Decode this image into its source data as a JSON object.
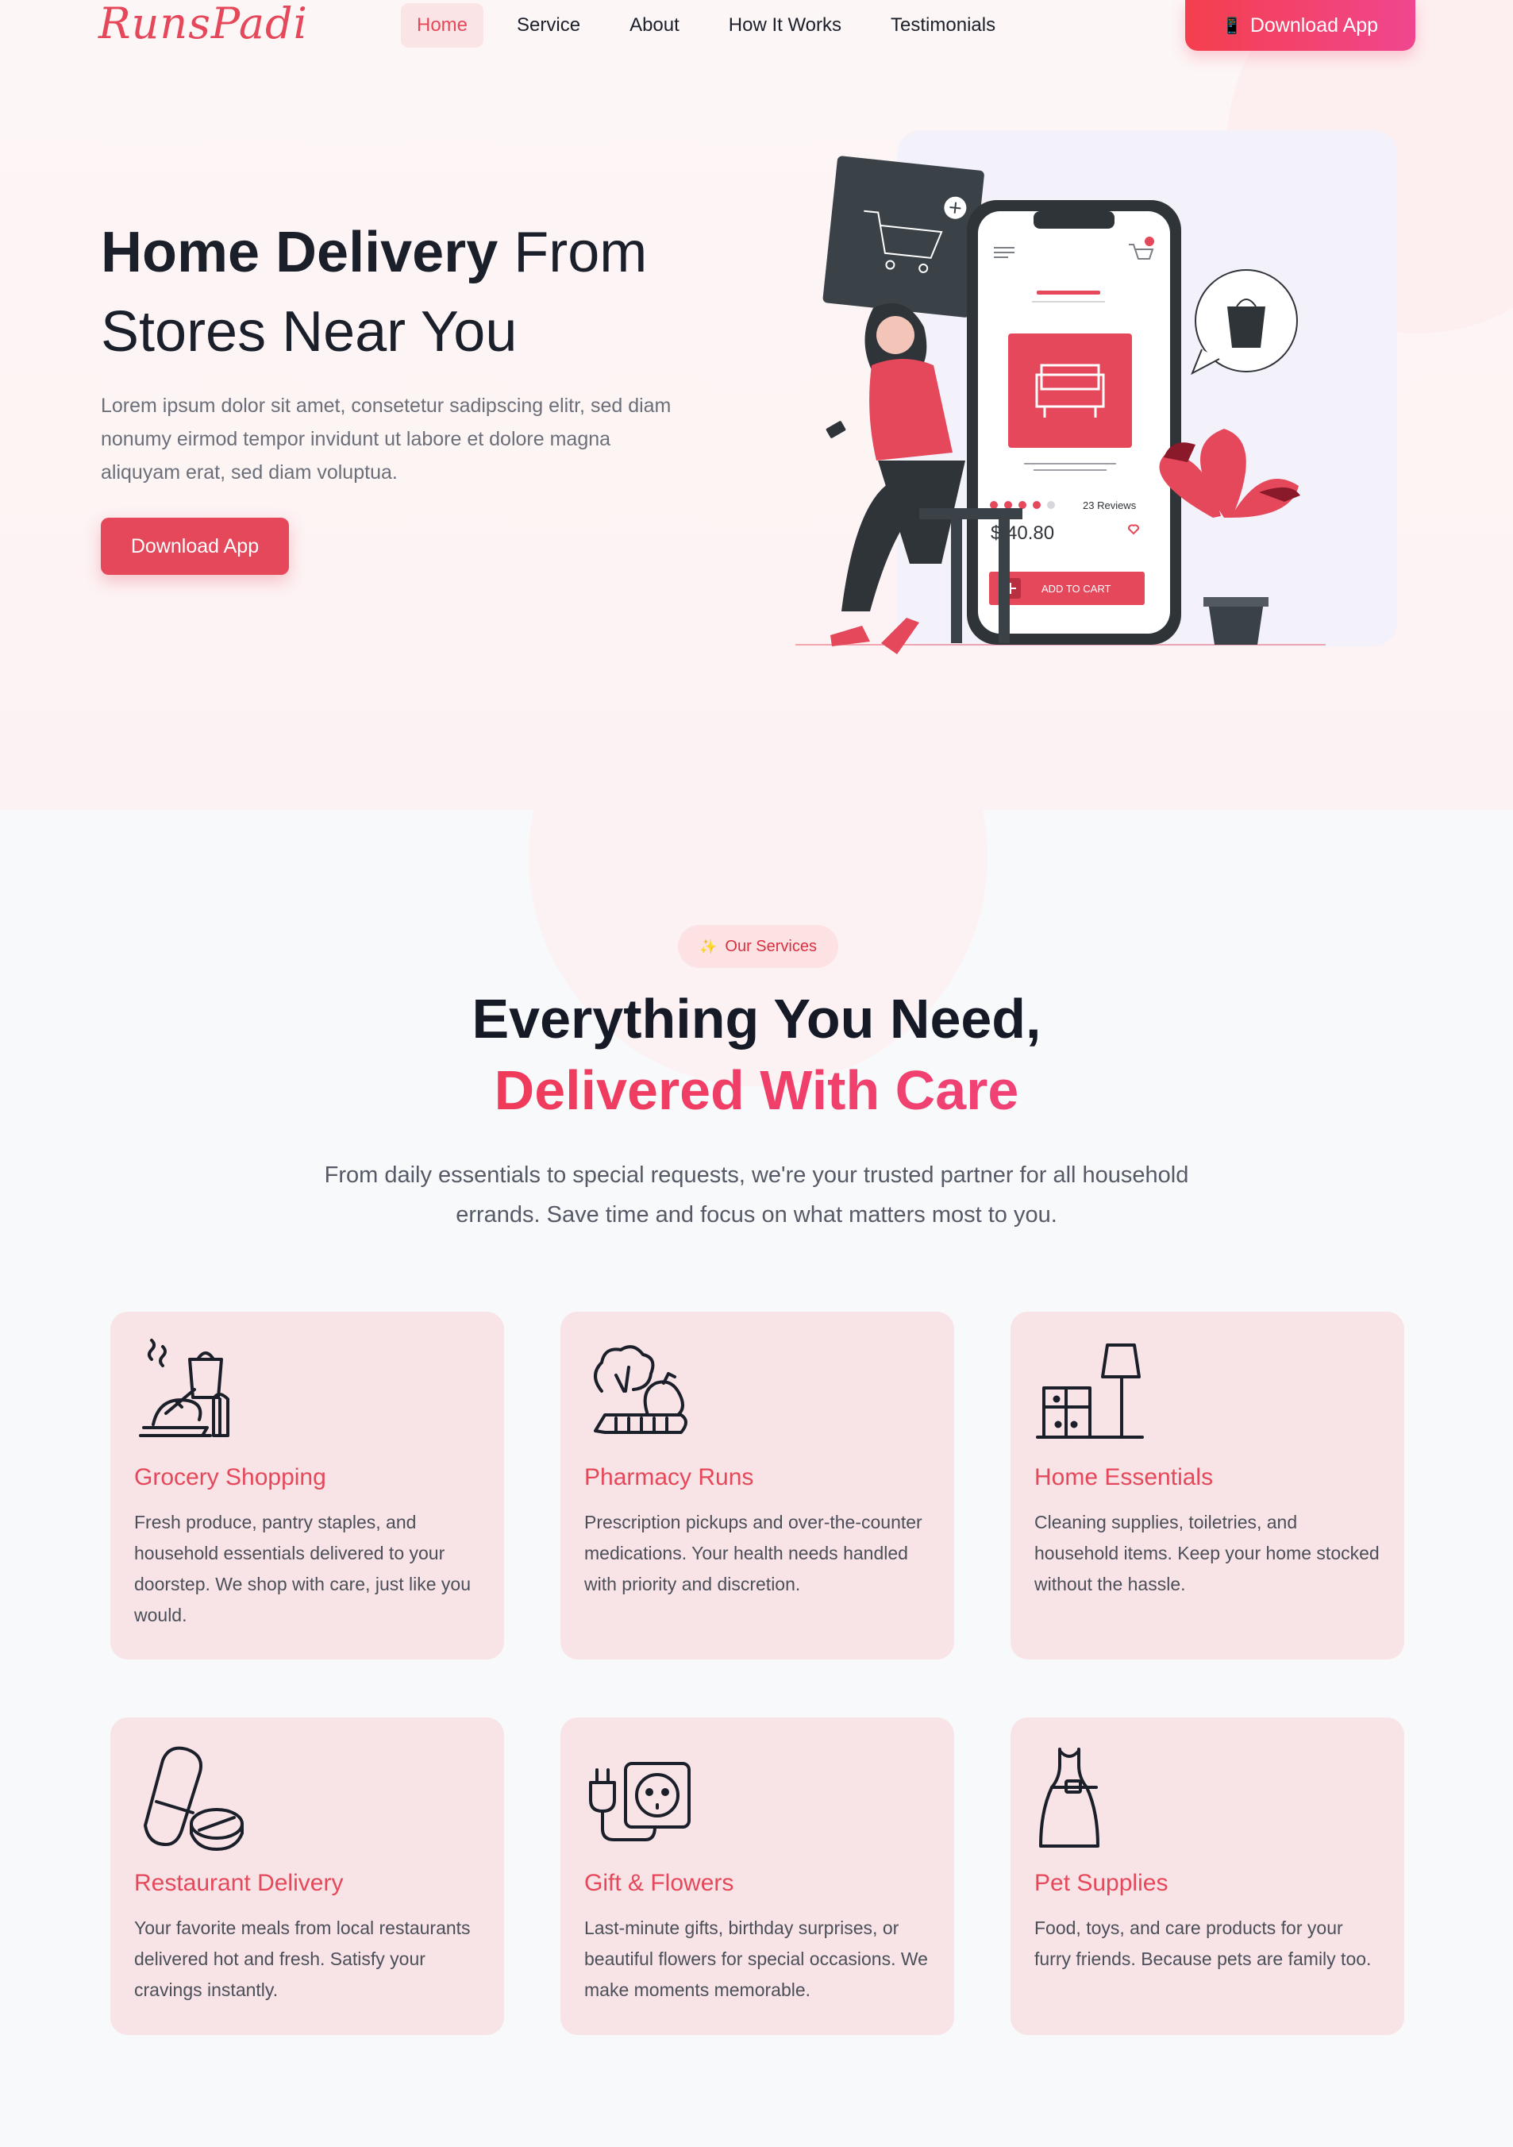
{
  "brand": {
    "logo_text": "RunsPadi",
    "primary_color": "#e5485a",
    "accent_gradient": [
      "#f43f4d",
      "#f0468f"
    ]
  },
  "nav": {
    "items": [
      {
        "label": "Home",
        "active": true
      },
      {
        "label": "Service",
        "active": false
      },
      {
        "label": "About",
        "active": false
      },
      {
        "label": "How It Works",
        "active": false
      },
      {
        "label": "Testimonials",
        "active": false
      }
    ],
    "cta_icon": "phone-icon",
    "cta_label": "Download App"
  },
  "hero": {
    "title_bold": "Home Delivery",
    "title_rest": " From Stores Near You",
    "text": "Lorem ipsum dolor sit amet, consetetur sadipscing elitr, sed diam nonumy eirmod tempor invidunt ut labore et dolore magna aliquyam erat, sed diam voluptua.",
    "button_label": "Download App",
    "illustration": {
      "reviews_label": "23 Reviews",
      "price": "$ 40.80",
      "add_to_cart_label": "ADD TO CART",
      "stars": 4
    }
  },
  "services": {
    "badge_icon": "sparkle-icon",
    "badge_label": "Our Services",
    "title_line1": "Everything You Need,",
    "title_line2": "Delivered With Care",
    "subtitle": "From daily essentials to special requests, we're your trusted partner for all household errands. Save time and focus on what matters most to you.",
    "cards": [
      {
        "icon": "grocery-icon",
        "title": "Grocery Shopping",
        "text": "Fresh produce, pantry staples, and household essentials delivered to your doorstep. We shop with care, just like you would."
      },
      {
        "icon": "vegetables-icon",
        "title": "Pharmacy Runs",
        "text": "Prescription pickups and over-the-counter medications. Your health needs handled with priority and discretion."
      },
      {
        "icon": "furniture-lamp-icon",
        "title": "Home Essentials",
        "text": "Cleaning supplies, toiletries, and household items. Keep your home stocked without the hassle."
      },
      {
        "icon": "pills-icon",
        "title": "Restaurant Delivery",
        "text": "Your favorite meals from local restaurants delivered hot and fresh. Satisfy your cravings instantly."
      },
      {
        "icon": "plug-socket-icon",
        "title": "Gift & Flowers",
        "text": "Last-minute gifts, birthday surprises, or beautiful flowers for special occasions. We make moments memorable."
      },
      {
        "icon": "dress-icon",
        "title": "Pet Supplies",
        "text": "Food, toys, and care products for your furry friends. Because pets are family too."
      }
    ]
  }
}
